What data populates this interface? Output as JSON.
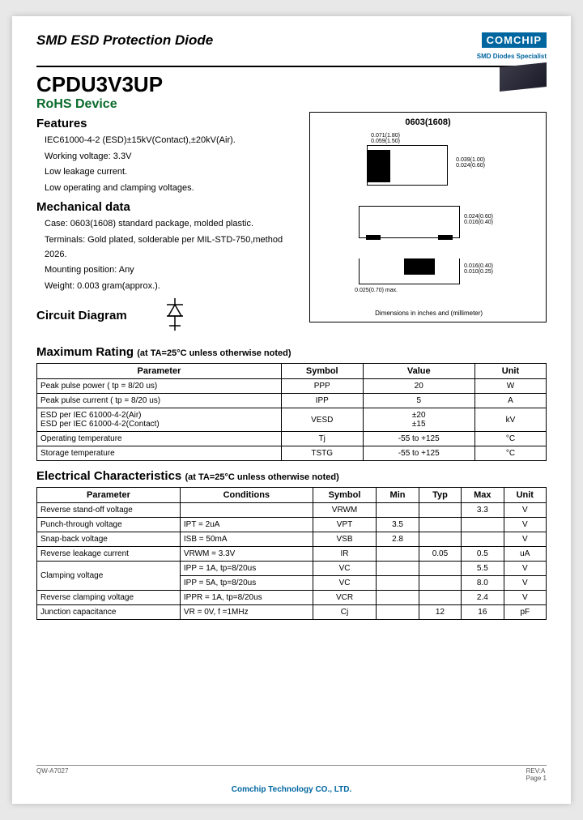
{
  "header": {
    "docTitle": "SMD ESD Protection Diode",
    "logo": "COMCHIP",
    "logoSub": "SMD Diodes Specialist",
    "partNo": "CPDU3V3UP",
    "rohs": "RoHS Device"
  },
  "features": {
    "head": "Features",
    "items": [
      "IEC61000-4-2 (ESD)±15kV(Contact),±20kV(Air).",
      "Working voltage: 3.3V",
      "Low leakage current.",
      "Low operating and clamping voltages."
    ]
  },
  "mechanical": {
    "head": "Mechanical data",
    "items": [
      "Case: 0603(1608) standard package, molded plastic.",
      "Terminals:  Gold plated, solderable per MIL-STD-750,method 2026.",
      "Mounting position: Any",
      "Weight: 0.003 gram(approx.)."
    ]
  },
  "circuit": {
    "head": "Circuit Diagram"
  },
  "package": {
    "title": "0603(1608)",
    "dim1": "0.071(1.80)\n0.059(1.50)",
    "dim2": "0.039(1.00)\n0.024(0.60)",
    "dim3": "0.024(0.60)\n0.016(0.40)",
    "dim4": "0.016(0.40)\n0.010(0.25)",
    "dim5": "0.025(0.70) max.",
    "note": "Dimensions in inches and (millimeter)"
  },
  "maxRating": {
    "head": "Maximum Rating ",
    "sub": "(at TA=25°C unless otherwise noted)",
    "headers": [
      "Parameter",
      "Symbol",
      "Value",
      "Unit"
    ],
    "rows": [
      [
        "Peak pulse power ( tp = 8/20 us)",
        "PPP",
        "20",
        "W"
      ],
      [
        "Peak pulse current ( tp = 8/20 us)",
        "IPP",
        "5",
        "A"
      ],
      [
        "ESD per IEC 61000-4-2(Air)\nESD per IEC 61000-4-2(Contact)",
        "VESD",
        "±20\n±15",
        "kV"
      ],
      [
        "Operating temperature",
        "Tj",
        "-55 to +125",
        "°C"
      ],
      [
        "Storage temperature",
        "TSTG",
        "-55 to +125",
        "°C"
      ]
    ]
  },
  "elecChar": {
    "head": "Electrical Characteristics ",
    "sub": "(at TA=25°C unless otherwise noted)",
    "headers": [
      "Parameter",
      "Conditions",
      "Symbol",
      "Min",
      "Typ",
      "Max",
      "Unit"
    ],
    "rows": [
      {
        "param": "Reverse stand-off voltage",
        "cond": "",
        "sym": "VRWM",
        "min": "",
        "typ": "",
        "max": "3.3",
        "unit": "V"
      },
      {
        "param": "Punch-through voltage",
        "cond": "IPT = 2uA",
        "sym": "VPT",
        "min": "3.5",
        "typ": "",
        "max": "",
        "unit": "V"
      },
      {
        "param": "Snap-back voltage",
        "cond": "ISB = 50mA",
        "sym": "VSB",
        "min": "2.8",
        "typ": "",
        "max": "",
        "unit": "V"
      },
      {
        "param": "Reverse leakage current",
        "cond": "VRWM = 3.3V",
        "sym": "IR",
        "min": "",
        "typ": "0.05",
        "max": "0.5",
        "unit": "uA"
      },
      {
        "param": "Clamping voltage",
        "cond": "IPP = 1A, tp=8/20us",
        "sym": "VC",
        "min": "",
        "typ": "",
        "max": "5.5",
        "unit": "V",
        "rowspan": 2
      },
      {
        "param": "",
        "cond": "IPP = 5A, tp=8/20us",
        "sym": "VC",
        "min": "",
        "typ": "",
        "max": "8.0",
        "unit": "V"
      },
      {
        "param": "Reverse clamping voltage",
        "cond": "IPPR = 1A, tp=8/20us",
        "sym": "VCR",
        "min": "",
        "typ": "",
        "max": "2.4",
        "unit": "V"
      },
      {
        "param": "Junction capacitance",
        "cond": "VR = 0V, f =1MHz",
        "sym": "Cj",
        "min": "",
        "typ": "12",
        "max": "16",
        "unit": "pF"
      }
    ]
  },
  "footer": {
    "docId": "QW-A7027",
    "rev": "REV:A",
    "page": "Page 1",
    "company": "Comchip Technology CO., LTD."
  }
}
